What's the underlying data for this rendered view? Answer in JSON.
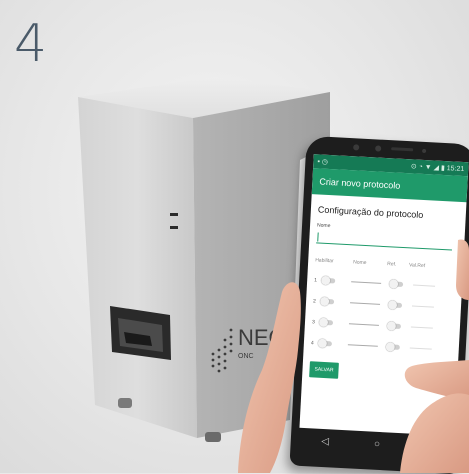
{
  "step_number": "4",
  "device": {
    "brand_text": "NEO",
    "brand_small": "ONC"
  },
  "phone": {
    "status_bar": {
      "left_icons": "▪ ◷",
      "right_text": "⊙ ◔ ▼ ◢ ▮ 15:21"
    },
    "app_bar_title": "Criar novo protocolo",
    "section_title": "Configuração do protocolo",
    "name_label": "Nome",
    "name_value": "",
    "columns": {
      "enable": "Habilitar",
      "name": "Nome",
      "ref": "Ref.",
      "val_ref": "Val.Ref"
    },
    "rows": [
      {
        "index": "1"
      },
      {
        "index": "2"
      },
      {
        "index": "3"
      },
      {
        "index": "4"
      }
    ],
    "save_label": "SALVAR",
    "nav": {
      "back": "◁",
      "home": "○",
      "recent": "□"
    }
  },
  "colors": {
    "primary": "#1f9a6a",
    "status": "#157a55",
    "step_number": "#4a5a69"
  }
}
